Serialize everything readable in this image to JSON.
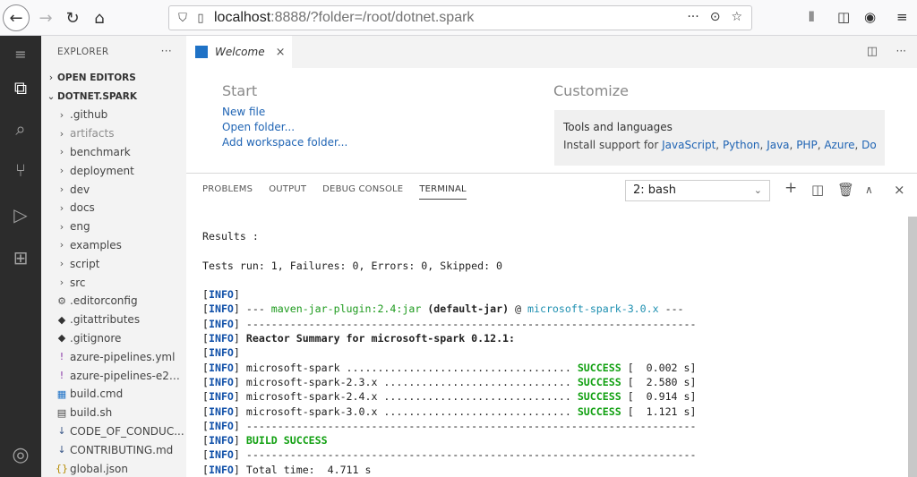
{
  "browser": {
    "url_host": "localhost",
    "url_rest": ":8888/?folder=/root/dotnet.spark",
    "actions": [
      "···",
      "⊙",
      "☆"
    ]
  },
  "sidebar": {
    "title": "EXPLORER",
    "more": "···",
    "open_editors": "OPEN EDITORS",
    "root": "DOTNET.SPARK",
    "items": [
      {
        "label": ".github",
        "icon": "›",
        "dim": false
      },
      {
        "label": "artifacts",
        "icon": "›",
        "dim": true
      },
      {
        "label": "benchmark",
        "icon": "›",
        "dim": false
      },
      {
        "label": "deployment",
        "icon": "›",
        "dim": false
      },
      {
        "label": "dev",
        "icon": "›",
        "dim": false
      },
      {
        "label": "docs",
        "icon": "›",
        "dim": false
      },
      {
        "label": "eng",
        "icon": "›",
        "dim": false
      },
      {
        "label": "examples",
        "icon": "›",
        "dim": false
      },
      {
        "label": "script",
        "icon": "›",
        "dim": false
      },
      {
        "label": "src",
        "icon": "›",
        "dim": false
      },
      {
        "label": ".editorconfig",
        "icon": "⚙",
        "dim": false
      },
      {
        "label": ".gitattributes",
        "icon": "◆",
        "dim": false
      },
      {
        "label": ".gitignore",
        "icon": "◆",
        "dim": false
      },
      {
        "label": "azure-pipelines.yml",
        "icon": "!",
        "dim": false
      },
      {
        "label": "azure-pipelines-e2e-...",
        "icon": "!",
        "dim": false
      },
      {
        "label": "build.cmd",
        "icon": "▦",
        "dim": false
      },
      {
        "label": "build.sh",
        "icon": "▤",
        "dim": false
      },
      {
        "label": "CODE_OF_CONDUC...",
        "icon": "↓",
        "dim": false
      },
      {
        "label": "CONTRIBUTING.md",
        "icon": "↓",
        "dim": false
      },
      {
        "label": "global.json",
        "icon": "{}",
        "dim": false
      }
    ]
  },
  "editor": {
    "tab_label": "Welcome",
    "tab_close": "×"
  },
  "welcome": {
    "start_heading": "Start",
    "links": [
      "New file",
      "Open folder...",
      "Add workspace folder..."
    ],
    "customize_heading": "Customize",
    "tools_title": "Tools and languages",
    "tools_prefix": "Install support for ",
    "tools_links": [
      "JavaScript",
      "Python",
      "Java",
      "PHP",
      "Azure",
      "Doc..."
    ]
  },
  "panel": {
    "tabs": [
      "PROBLEMS",
      "OUTPUT",
      "DEBUG CONSOLE",
      "TERMINAL"
    ],
    "active_tab": "TERMINAL",
    "terminal_select": "2: bash"
  },
  "terminal": {
    "results": "Results :",
    "tests": "Tests run: 1, Failures: 0, Errors: 0, Skipped: 0",
    "info_tag": "INFO",
    "plugin": "maven-jar-plugin:2.4:jar",
    "plugin_goal": "(default-jar)",
    "plugin_project": "microsoft-spark-3.0.x",
    "separator": "------------------------------------------------------------------------",
    "reactor": "Reactor Summary for microsoft-spark 0.12.1:",
    "modules": [
      {
        "name": "microsoft-spark ....................................",
        "status": "SUCCESS",
        "time": "[  0.002 s]"
      },
      {
        "name": "microsoft-spark-2.3.x ..............................",
        "status": "SUCCESS",
        "time": "[  2.580 s]"
      },
      {
        "name": "microsoft-spark-2.4.x ..............................",
        "status": "SUCCESS",
        "time": "[  0.914 s]"
      },
      {
        "name": "microsoft-spark-3.0.x ..............................",
        "status": "SUCCESS",
        "time": "[  1.121 s]"
      }
    ],
    "build_success": "BUILD SUCCESS",
    "total_time": "Total time:  4.711 s"
  }
}
